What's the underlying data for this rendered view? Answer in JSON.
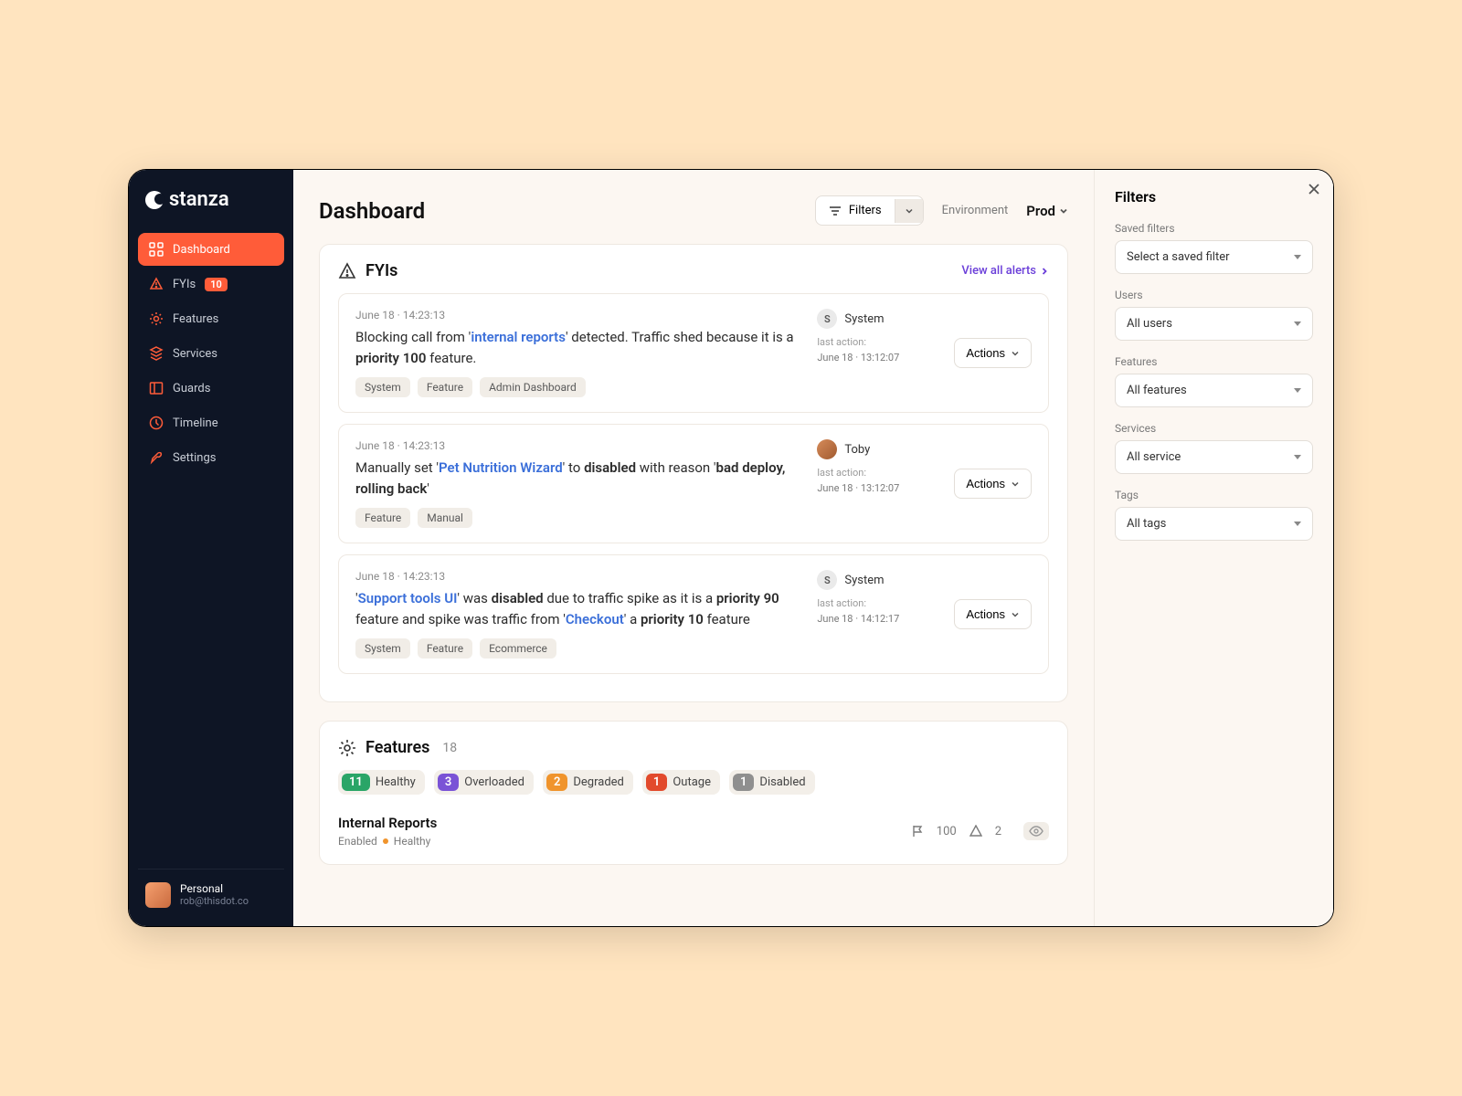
{
  "brand": "stanza",
  "sidebar": {
    "items": [
      {
        "label": "Dashboard"
      },
      {
        "label": "FYIs",
        "badge": "10"
      },
      {
        "label": "Features"
      },
      {
        "label": "Services"
      },
      {
        "label": "Guards"
      },
      {
        "label": "Timeline"
      },
      {
        "label": "Settings"
      }
    ],
    "user": {
      "name": "Personal",
      "email": "rob@thisdot.co"
    }
  },
  "header": {
    "title": "Dashboard",
    "filters_btn": "Filters",
    "env_label": "Environment",
    "env_value": "Prod"
  },
  "fyis": {
    "title": "FYIs",
    "view_all": "View all alerts",
    "items": [
      {
        "date": "June 18",
        "time": "14:23:13",
        "msg_pre": "Blocking call from '",
        "msg_link": "internal reports",
        "msg_mid": "' detected. Traffic shed because it is a ",
        "msg_bold": "priority 100",
        "msg_post": " feature.",
        "tags": [
          "System",
          "Feature",
          "Admin Dashboard"
        ],
        "actor_type": "initial",
        "actor_initial": "S",
        "actor": "System",
        "last_action_label": "last action:",
        "last_action_date": "June 18",
        "last_action_time": "13:12:07",
        "actions_label": "Actions"
      },
      {
        "date": "June 18",
        "time": "14:23:13",
        "msg_pre": "Manually set '",
        "msg_link": "Pet Nutrition Wizard",
        "msg_mid": "' to ",
        "msg_bold": "disabled",
        "msg_post2_pre": " with reason '",
        "msg_bold2": "bad deploy, rolling back",
        "msg_post2": "'",
        "tags": [
          "Feature",
          "Manual"
        ],
        "actor_type": "img",
        "actor": "Toby",
        "last_action_label": "last action:",
        "last_action_date": "June 18",
        "last_action_time": "13:12:07",
        "actions_label": "Actions"
      },
      {
        "date": "June 18",
        "time": "14:23:13",
        "msg3_l1": "Support tools UI",
        "msg3_t1": "' was ",
        "msg3_b1": "disabled",
        "msg3_t2": " due to traffic spike as it is a ",
        "msg3_b2": "priority 90",
        "msg3_t3": " feature and spike was traffic from '",
        "msg3_l2": "Checkout",
        "msg3_t4": "' a ",
        "msg3_b3": "priority 10",
        "msg3_t5": " feature",
        "tags": [
          "System",
          "Feature",
          "Ecommerce"
        ],
        "actor_type": "initial",
        "actor_initial": "S",
        "actor": "System",
        "last_action_label": "last action:",
        "last_action_date": "June 18",
        "last_action_time": "14:12:17",
        "actions_label": "Actions"
      }
    ]
  },
  "features": {
    "title": "Features",
    "count": "18",
    "stats": [
      {
        "count": "11",
        "label": "Healthy",
        "color": "c-green"
      },
      {
        "count": "3",
        "label": "Overloaded",
        "color": "c-purple"
      },
      {
        "count": "2",
        "label": "Degraded",
        "color": "c-orange"
      },
      {
        "count": "1",
        "label": "Outage",
        "color": "c-red"
      },
      {
        "count": "1",
        "label": "Disabled",
        "color": "c-gray"
      }
    ],
    "row": {
      "title": "Internal Reports",
      "status1": "Enabled",
      "status2": "Healthy",
      "flag_count": "100",
      "warn_count": "2"
    }
  },
  "filters": {
    "title": "Filters",
    "groups": [
      {
        "label": "Saved filters",
        "value": "Select a saved filter"
      },
      {
        "label": "Users",
        "value": "All users"
      },
      {
        "label": "Features",
        "value": "All features"
      },
      {
        "label": "Services",
        "value": "All service"
      },
      {
        "label": "Tags",
        "value": "All tags"
      }
    ]
  }
}
